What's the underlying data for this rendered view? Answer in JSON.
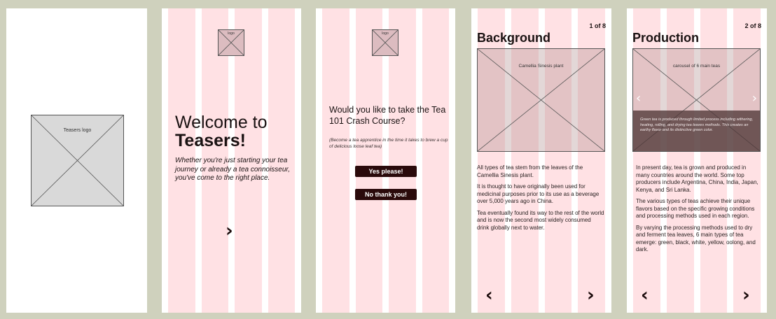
{
  "frame1": {
    "logo_label": "Teasers logo"
  },
  "frame2": {
    "logo_label": "logo",
    "welcome": "Welcome to",
    "brand": "Teasers!",
    "tagline": "Whether you're just starting your tea journey or already a tea connoisseur, you've come to the right place.",
    "next_glyph": "›"
  },
  "frame3": {
    "logo_label": "logo",
    "question": "Would you like to take the Tea 101 Crash Course?",
    "subtext": "(Become a tea apprentice in the time it takes to brew a cup of delicious loose leaf tea)",
    "yes_label": "Yes please!",
    "no_label": "No thank you!"
  },
  "frame4": {
    "title": "Background",
    "page": "1 of 8",
    "image_label": "Camellia Sinesis plant",
    "paragraphs": [
      "All types of tea stem from the leaves of the Camellia Sinesis plant.",
      "It is thought to have originally been used for medicinal purposes prior to its use as a beverage over 5,000 years ago in China.",
      "Tea eventually found its way to the rest of the world and is now the second most widely consumed drink globally next to water."
    ],
    "prev_glyph": "‹",
    "next_glyph": "›"
  },
  "frame5": {
    "title": "Production",
    "page": "2 of 8",
    "image_label": "carousel of 6 main teas",
    "caption": "Green tea is produced through limited process including withering, heating, rolling, and drying tea leaves methods. This creates an earthy flavor and its distinctive green color.",
    "paragraphs": [
      "In present day, tea is grown and produced in many countries around the world. Some top producers include Argentina, China, India, Japan, Kenya, and Sri Lanka.",
      "The various types of teas achieve their unique flavors based on the specific growing conditions and processing methods used in each region.",
      "By varying the processing methods used to dry and ferment tea leaves, 6 main types of tea emerge: green, black, white, yellow, oolong, and dark."
    ],
    "prev_glyph": "‹",
    "next_glyph": "›",
    "carousel_prev": "‹",
    "carousel_next": "›"
  }
}
